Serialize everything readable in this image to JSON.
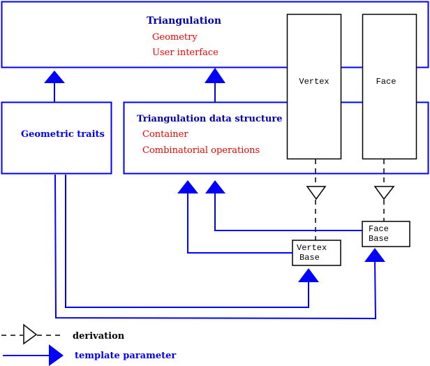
{
  "colors": {
    "blue": "#0000ff",
    "dark_blue": "#0000aa",
    "red": "#ee0000",
    "black": "#000000"
  },
  "triangulation": {
    "title": "Triangulation",
    "items": [
      "Geometry",
      "User interface"
    ]
  },
  "vertex": {
    "label": "Vertex"
  },
  "face": {
    "label": "Face"
  },
  "geometric_traits": {
    "title": "Geometric traits"
  },
  "tds": {
    "title": "Triangulation data structure",
    "items": [
      "Container",
      "Combinatorial operations"
    ]
  },
  "vertex_base": {
    "line1": "Vertex",
    "line2": "Base"
  },
  "face_base": {
    "line1": "Face",
    "line2": "Base"
  },
  "legend": {
    "derivation": "derivation",
    "template_parameter": "template parameter"
  }
}
